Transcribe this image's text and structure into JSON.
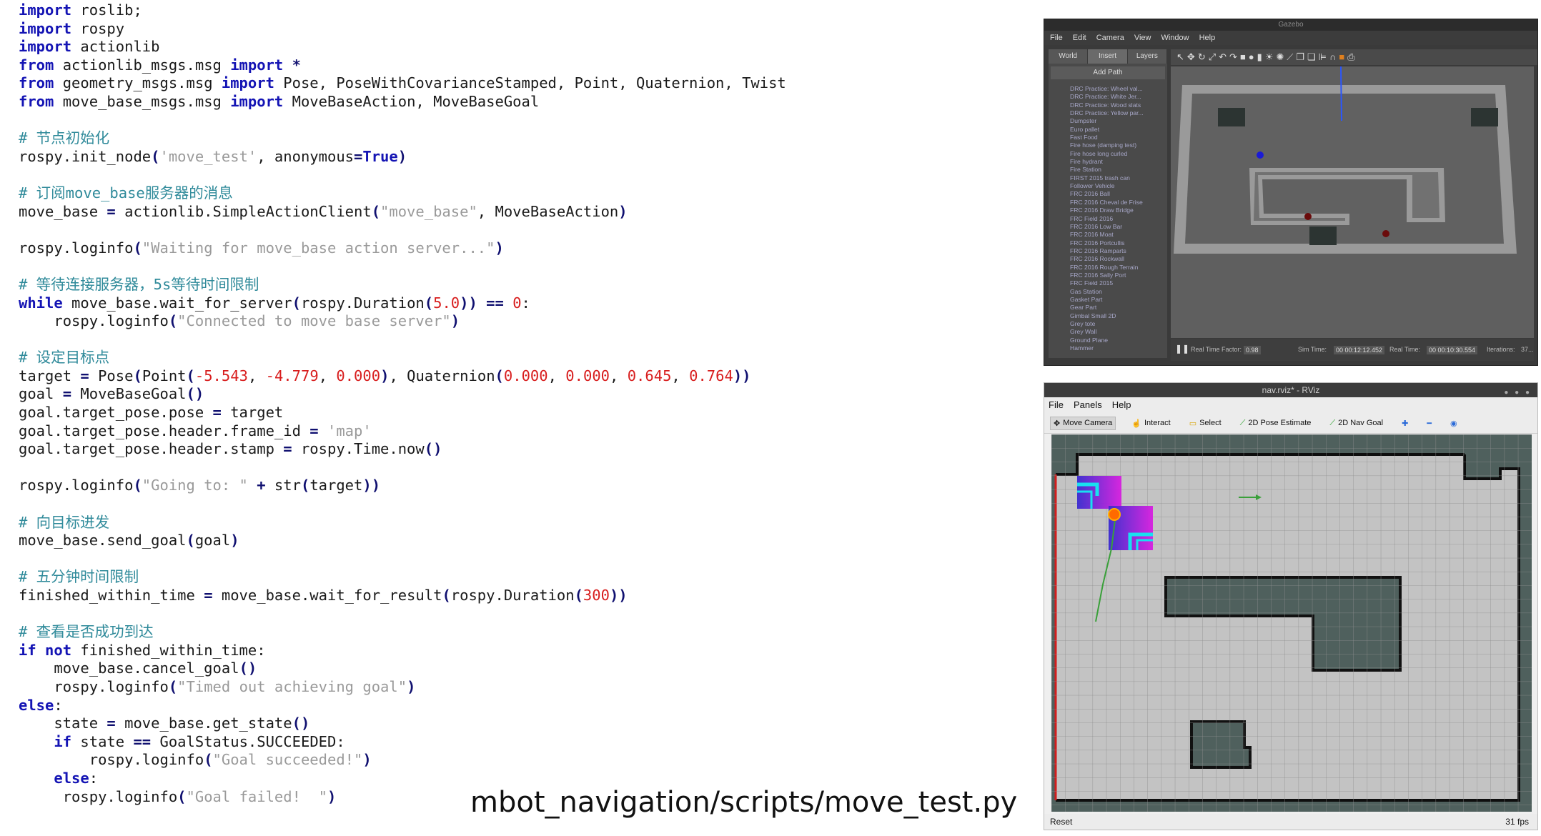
{
  "code": {
    "lines": [
      [
        [
          "kw",
          "import"
        ],
        [
          "p",
          " roslib;"
        ]
      ],
      [
        [
          "kw",
          "import"
        ],
        [
          "p",
          " rospy"
        ]
      ],
      [
        [
          "kw",
          "import"
        ],
        [
          "p",
          " actionlib"
        ]
      ],
      [
        [
          "kw",
          "from"
        ],
        [
          "p",
          " actionlib_msgs.msg "
        ],
        [
          "kw",
          "import"
        ],
        [
          "op",
          " *"
        ]
      ],
      [
        [
          "kw",
          "from"
        ],
        [
          "p",
          " geometry_msgs.msg "
        ],
        [
          "kw",
          "import"
        ],
        [
          "p",
          " Pose, PoseWithCovarianceStamped, Point, Quaternion, Twist"
        ]
      ],
      [
        [
          "kw",
          "from"
        ],
        [
          "p",
          " move_base_msgs.msg "
        ],
        [
          "kw",
          "import"
        ],
        [
          "p",
          " MoveBaseAction, MoveBaseGoal"
        ]
      ],
      [],
      [
        [
          "cm",
          "# 节点初始化"
        ]
      ],
      [
        [
          "p",
          "rospy.init_node"
        ],
        [
          "op",
          "("
        ],
        [
          "str",
          "'move_test'"
        ],
        [
          "p",
          ", anonymous"
        ],
        [
          "op",
          "="
        ],
        [
          "kw",
          "True"
        ],
        [
          "op",
          ")"
        ]
      ],
      [],
      [
        [
          "cm",
          "# 订阅move_base服务器的消息"
        ]
      ],
      [
        [
          "p",
          "move_base "
        ],
        [
          "op",
          "="
        ],
        [
          "p",
          " actionlib.SimpleActionClient"
        ],
        [
          "op",
          "("
        ],
        [
          "str",
          "\"move_base\""
        ],
        [
          "p",
          ", MoveBaseAction"
        ],
        [
          "op",
          ")"
        ]
      ],
      [],
      [
        [
          "p",
          "rospy.loginfo"
        ],
        [
          "op",
          "("
        ],
        [
          "str",
          "\"Waiting for move_base action server...\""
        ],
        [
          "op",
          ")"
        ]
      ],
      [],
      [
        [
          "cm",
          "# 等待连接服务器，5s等待时间限制"
        ]
      ],
      [
        [
          "kw",
          "while"
        ],
        [
          "p",
          " move_base.wait_for_server"
        ],
        [
          "op",
          "("
        ],
        [
          "p",
          "rospy.Duration"
        ],
        [
          "op",
          "("
        ],
        [
          "num",
          "5.0"
        ],
        [
          "op",
          "))"
        ],
        [
          "p",
          " "
        ],
        [
          "op",
          "=="
        ],
        [
          "p",
          " "
        ],
        [
          "num",
          "0"
        ],
        [
          "p",
          ":"
        ]
      ],
      [
        [
          "p",
          "    rospy.loginfo"
        ],
        [
          "op",
          "("
        ],
        [
          "str",
          "\"Connected to move base server\""
        ],
        [
          "op",
          ")"
        ]
      ],
      [],
      [
        [
          "cm",
          "# 设定目标点"
        ]
      ],
      [
        [
          "p",
          "target "
        ],
        [
          "op",
          "="
        ],
        [
          "p",
          " Pose"
        ],
        [
          "op",
          "("
        ],
        [
          "p",
          "Point"
        ],
        [
          "op",
          "("
        ],
        [
          "num",
          "-5.543"
        ],
        [
          "p",
          ", "
        ],
        [
          "num",
          "-4.779"
        ],
        [
          "p",
          ", "
        ],
        [
          "num",
          "0.000"
        ],
        [
          "op",
          ")"
        ],
        [
          "p",
          ", Quaternion"
        ],
        [
          "op",
          "("
        ],
        [
          "num",
          "0.000"
        ],
        [
          "p",
          ", "
        ],
        [
          "num",
          "0.000"
        ],
        [
          "p",
          ", "
        ],
        [
          "num",
          "0.645"
        ],
        [
          "p",
          ", "
        ],
        [
          "num",
          "0.764"
        ],
        [
          "op",
          "))"
        ]
      ],
      [
        [
          "p",
          "goal "
        ],
        [
          "op",
          "="
        ],
        [
          "p",
          " MoveBaseGoal"
        ],
        [
          "op",
          "()"
        ]
      ],
      [
        [
          "p",
          "goal.target_pose.pose "
        ],
        [
          "op",
          "="
        ],
        [
          "p",
          " target"
        ]
      ],
      [
        [
          "p",
          "goal.target_pose.header.frame_id "
        ],
        [
          "op",
          "="
        ],
        [
          "p",
          " "
        ],
        [
          "str",
          "'map'"
        ]
      ],
      [
        [
          "p",
          "goal.target_pose.header.stamp "
        ],
        [
          "op",
          "="
        ],
        [
          "p",
          " rospy.Time.now"
        ],
        [
          "op",
          "()"
        ]
      ],
      [],
      [
        [
          "p",
          "rospy.loginfo"
        ],
        [
          "op",
          "("
        ],
        [
          "str",
          "\"Going to: \""
        ],
        [
          "p",
          " "
        ],
        [
          "op",
          "+"
        ],
        [
          "p",
          " str"
        ],
        [
          "op",
          "("
        ],
        [
          "p",
          "target"
        ],
        [
          "op",
          "))"
        ]
      ],
      [],
      [
        [
          "cm",
          "# 向目标进发"
        ]
      ],
      [
        [
          "p",
          "move_base.send_goal"
        ],
        [
          "op",
          "("
        ],
        [
          "p",
          "goal"
        ],
        [
          "op",
          ")"
        ]
      ],
      [],
      [
        [
          "cm",
          "# 五分钟时间限制"
        ]
      ],
      [
        [
          "p",
          "finished_within_time "
        ],
        [
          "op",
          "="
        ],
        [
          "p",
          " move_base.wait_for_result"
        ],
        [
          "op",
          "("
        ],
        [
          "p",
          "rospy.Duration"
        ],
        [
          "op",
          "("
        ],
        [
          "num",
          "300"
        ],
        [
          "op",
          "))"
        ]
      ],
      [],
      [
        [
          "cm",
          "# 查看是否成功到达"
        ]
      ],
      [
        [
          "kw",
          "if"
        ],
        [
          "p",
          " "
        ],
        [
          "kw",
          "not"
        ],
        [
          "p",
          " finished_within_time:"
        ]
      ],
      [
        [
          "p",
          "    move_base.cancel_goal"
        ],
        [
          "op",
          "()"
        ]
      ],
      [
        [
          "p",
          "    rospy.loginfo"
        ],
        [
          "op",
          "("
        ],
        [
          "str",
          "\"Timed out achieving goal\""
        ],
        [
          "op",
          ")"
        ]
      ],
      [
        [
          "kw",
          "else"
        ],
        [
          "p",
          ":"
        ]
      ],
      [
        [
          "p",
          "    state "
        ],
        [
          "op",
          "="
        ],
        [
          "p",
          " move_base.get_state"
        ],
        [
          "op",
          "()"
        ]
      ],
      [
        [
          "p",
          "    "
        ],
        [
          "kw",
          "if"
        ],
        [
          "p",
          " state "
        ],
        [
          "op",
          "=="
        ],
        [
          "p",
          " GoalStatus.SUCCEEDED:"
        ]
      ],
      [
        [
          "p",
          "        rospy.loginfo"
        ],
        [
          "op",
          "("
        ],
        [
          "str",
          "\"Goal succeeded!\""
        ],
        [
          "op",
          ")"
        ]
      ],
      [
        [
          "p",
          "    "
        ],
        [
          "kw",
          "else"
        ],
        [
          "p",
          ":"
        ]
      ],
      [
        [
          "p",
          "     rospy.loginfo"
        ],
        [
          "op",
          "("
        ],
        [
          "str",
          "\"Goal failed!  \""
        ],
        [
          "op",
          ")"
        ]
      ]
    ]
  },
  "caption": "mbot_navigation/scripts/move_test.py",
  "gazebo": {
    "title": "Gazebo",
    "menu": [
      "File",
      "Edit",
      "Camera",
      "View",
      "Window",
      "Help"
    ],
    "tabs": [
      "World",
      "Insert",
      "Layers"
    ],
    "add_path": "Add Path",
    "models": [
      "DRC Practice: Wheel val...",
      "DRC Practice: White Jer...",
      "DRC Practice: Wood slats",
      "DRC Practice: Yellow par...",
      "Dumpster",
      "Euro pallet",
      "Fast Food",
      "Fire hose (damping test)",
      "Fire hose long curled",
      "Fire hydrant",
      "Fire Station",
      "FIRST 2015 trash can",
      "Follower Vehicle",
      "FRC 2016 Ball",
      "FRC 2016 Cheval de Frise",
      "FRC 2016 Draw Bridge",
      "FRC Field 2016",
      "FRC 2016 Low Bar",
      "FRC 2016 Moat",
      "FRC 2016 Portcullis",
      "FRC 2016 Ramparts",
      "FRC 2016 Rockwall",
      "FRC 2016 Rough Terrain",
      "FRC 2016 Sally Port",
      "FRC Field 2015",
      "Gas Station",
      "Gasket Part",
      "Gear Part",
      "Gimbal Small 2D",
      "Grey tote",
      "Grey Wall",
      "Ground Plane",
      "Hammer"
    ],
    "status": {
      "real_time_factor_label": "Real Time Factor:",
      "real_time_factor": "0.98",
      "sim_time_label": "Sim Time:",
      "sim_time": "00 00:12:12.452",
      "real_time_label": "Real Time:",
      "real_time": "00 00:10:30.554",
      "iterations_label": "Iterations:",
      "iterations": "37..."
    }
  },
  "rviz": {
    "title": "nav.rviz* - RViz",
    "menu": [
      "File",
      "Panels",
      "Help"
    ],
    "tools": [
      "Move Camera",
      "Interact",
      "Select",
      "2D Pose Estimate",
      "2D Nav Goal"
    ],
    "reset": "Reset",
    "fps": "31 fps"
  },
  "colors": {
    "keyword": "#1414b4",
    "string": "#9a9a9a",
    "number": "#d81e1e",
    "comment": "#2f8a9a",
    "map_free": "#c3c3c3",
    "map_unknown": "#4f605d",
    "costmap_high": "#d81ee0",
    "costmap_low": "#3a2bd0",
    "inflation": "#18e0f0",
    "robot": "#ff6a00",
    "path": "#3aa03a"
  }
}
